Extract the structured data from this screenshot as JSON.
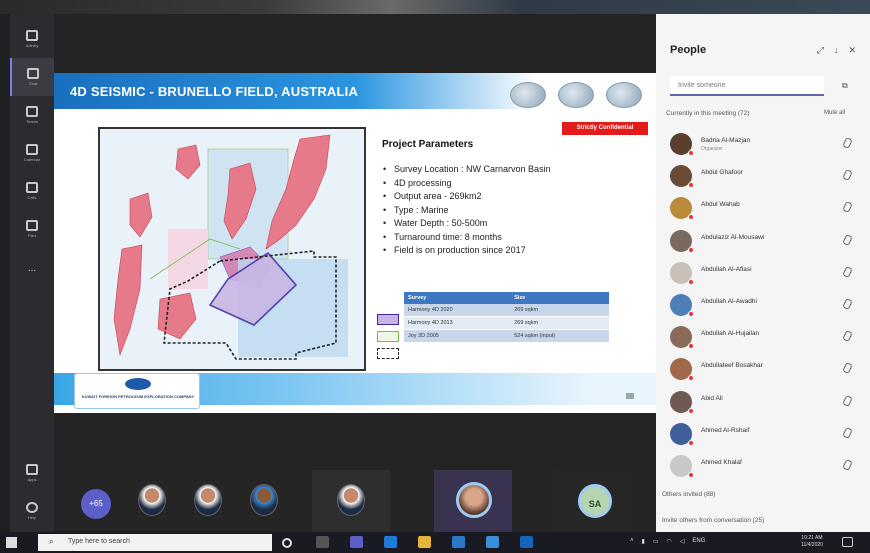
{
  "app": {
    "name": "Microsoft Teams meeting"
  },
  "rail": {
    "items": [
      {
        "label": "Activity",
        "active": false
      },
      {
        "label": "Chat",
        "active": true
      },
      {
        "label": "Teams",
        "active": false
      },
      {
        "label": "Calendar",
        "active": false
      },
      {
        "label": "Calls",
        "active": false
      },
      {
        "label": "Files",
        "active": false
      },
      {
        "label": "...",
        "active": false
      }
    ],
    "bottom": [
      {
        "label": "Apps"
      },
      {
        "label": "Help"
      }
    ]
  },
  "slide": {
    "title": "4D SEISMIC - BRUNELLO FIELD, AUSTRALIA",
    "confidential_label": "Strictly Confidential",
    "params_heading": "Project Parameters",
    "params": [
      "Survey Location : NW Carnarvon Basin",
      "4D processing",
      "Output area - 269km2",
      "Type : Marine",
      "Water Depth : 50-500m",
      "Turnaround time: 8 months",
      "Field is on production since 2017"
    ],
    "survey_table": {
      "headers": [
        "Survey",
        "Size"
      ],
      "rows": [
        [
          "Harmony 4D 2020",
          "269 sqkm"
        ],
        [
          "Harmony 4D 2013",
          "269 sqkm"
        ],
        [
          "Joy 3D 2005",
          "524 sqkm (input)"
        ]
      ]
    },
    "logo_text": "KUFPEC",
    "logo_subtext": "KUWAIT FOREIGN PETROLEUM EXPLORATION COMPANY"
  },
  "strip": {
    "more_count": "+65",
    "initials_badge": "SA"
  },
  "people": {
    "title": "People",
    "invite_placeholder": "Invite someone",
    "currently_label": "Currently in this meeting (72)",
    "mute_all": "Mute all",
    "participants": [
      {
        "name": "Badria Al-Mazjan",
        "role": "Organizer",
        "avatar_color": "#5a3e2e"
      },
      {
        "name": "Abdul Ghafoor",
        "role": "",
        "avatar_color": "#6b4a36"
      },
      {
        "name": "Abdul Wahab",
        "role": "",
        "avatar_color": "#b88a3a"
      },
      {
        "name": "Abdulaziz Al-Mousawi",
        "role": "",
        "avatar_color": "#7a6a5e"
      },
      {
        "name": "Abdullah Al-Aflasi",
        "role": "",
        "avatar_color": "#c9c0b8"
      },
      {
        "name": "Abdullah Al-Awadhi",
        "role": "",
        "avatar_color": "#4f7fb8"
      },
      {
        "name": "Abdullah Al-Hujailan",
        "role": "",
        "avatar_color": "#8a6a58"
      },
      {
        "name": "Abdullateef Bosakhar",
        "role": "",
        "avatar_color": "#a06a4a"
      },
      {
        "name": "Abid Ali",
        "role": "",
        "avatar_color": "#6e5a52"
      },
      {
        "name": "Ahmed Al-Rshaif",
        "role": "",
        "avatar_color": "#3e5f9a"
      },
      {
        "name": "Ahmed Khalaf",
        "role": "",
        "avatar_color": "#c8c8c8"
      }
    ],
    "others_invited": "Others invited (88)",
    "invite_from_conv": "Invite others from conversation (25)"
  },
  "taskbar": {
    "search_placeholder": "Type here to search",
    "lang": "ENG",
    "time": "10:21 AM",
    "date": "11/4/2020"
  }
}
